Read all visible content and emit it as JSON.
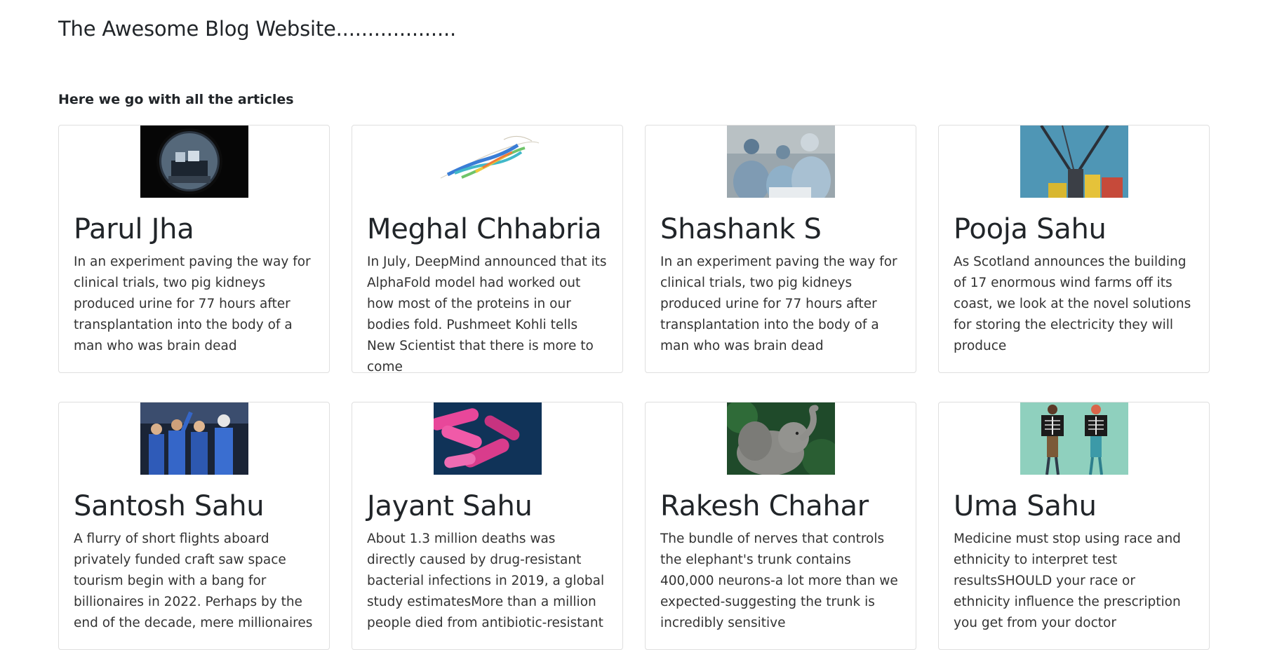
{
  "site": {
    "title": "The Awesome Blog Website...................",
    "section_heading": "Here we go with all the articles"
  },
  "articles": [
    {
      "author": "Parul Jha",
      "summary": "In an experiment paving the way for clinical trials, two pig kidneys produced urine for 77 hours after transplantation into the body of a man who was brain dead",
      "image_icon": "fisheye-lens-icon"
    },
    {
      "author": "Meghal Chhabria",
      "summary": "In July, DeepMind announced that its AlphaFold model had worked out how most of the proteins in our bodies fold. Pushmeet Kohli tells New Scientist that there is more to come",
      "image_icon": "protein-structure-icon"
    },
    {
      "author": "Shashank S",
      "summary": "In an experiment paving the way for clinical trials, two pig kidneys produced urine for 77 hours after transplantation into the body of a man who was brain dead",
      "image_icon": "surgeons-icon"
    },
    {
      "author": "Pooja Sahu",
      "summary": "As Scotland announces the building of 17 enormous wind farms off its coast, we look at the novel solutions for storing the electricity they will produce",
      "image_icon": "wind-turbine-crane-icon"
    },
    {
      "author": "Santosh Sahu",
      "summary": "A flurry of short flights aboard privately funded craft saw space tourism begin with a bang for billionaires in 2022. Perhaps by the end of the decade, mere millionaires",
      "image_icon": "astronauts-icon"
    },
    {
      "author": "Jayant Sahu",
      "summary": "About 1.3 million deaths was directly caused by drug-resistant bacterial infections in 2019, a global study estimatesMore than a million people died from antibiotic-resistant",
      "image_icon": "bacteria-icon"
    },
    {
      "author": "Rakesh Chahar",
      "summary": "The bundle of nerves that controls the elephant's trunk contains 400,000 neurons-a lot more than we expected-suggesting the trunk is incredibly sensitive",
      "image_icon": "elephant-icon"
    },
    {
      "author": "Uma Sahu",
      "summary": "Medicine must stop using race and ethnicity to interpret test resultsSHOULD your race or ethnicity influence the prescription you get from your doctor",
      "image_icon": "xray-people-icon"
    }
  ]
}
